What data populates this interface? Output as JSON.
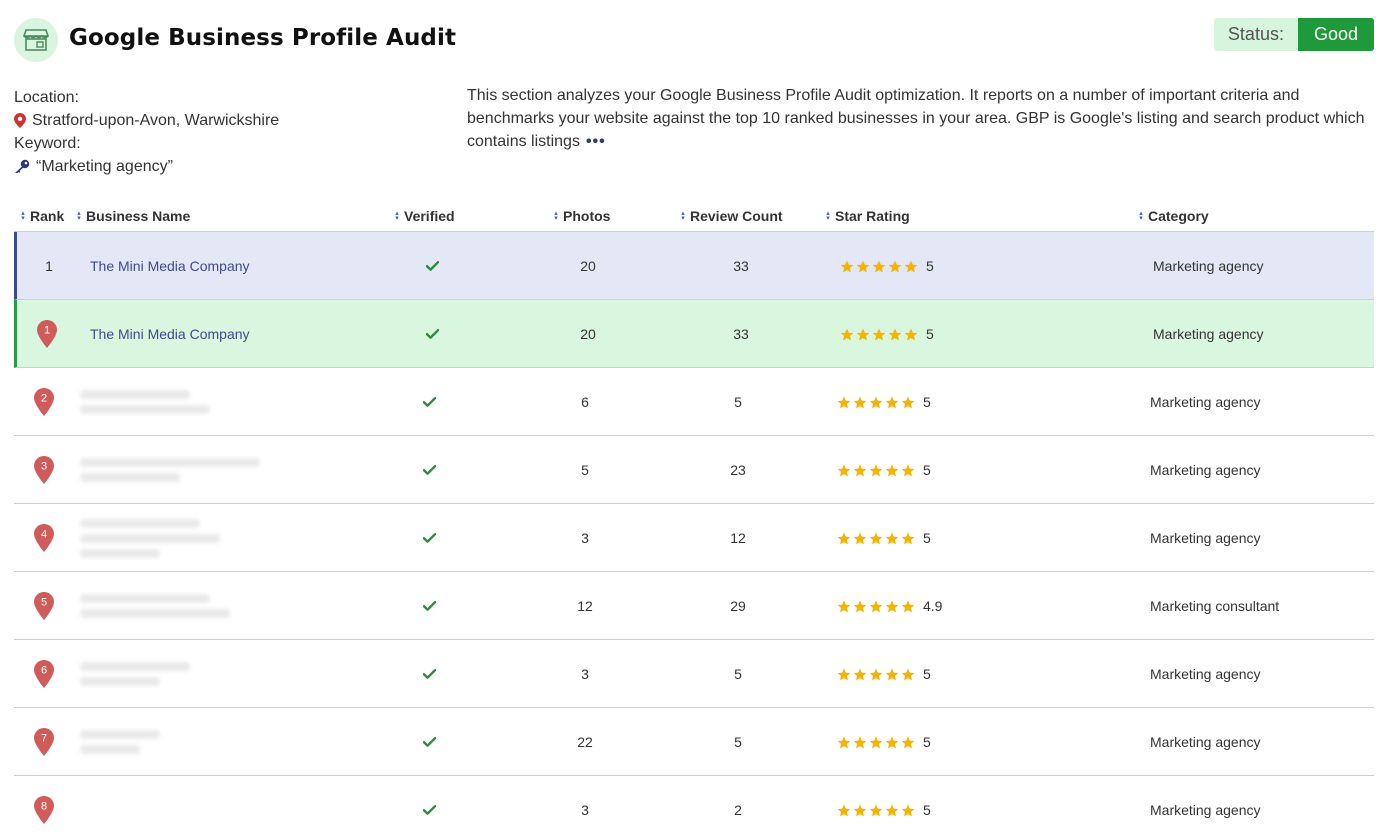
{
  "header": {
    "title": "Google Business Profile Audit",
    "status_label": "Status:",
    "status_value": "Good"
  },
  "meta": {
    "location_label": "Location:",
    "location_value": "Stratford-upon-Avon, Warwickshire",
    "keyword_label": "Keyword:",
    "keyword_value": "“Marketing agency”"
  },
  "description": {
    "text": "This section analyzes your Google Business Profile Audit optimization. It reports on a number of important criteria and benchmarks your website against the top 10 ranked businesses in your area. GBP is Google's listing and search product which contains listings",
    "more": "•••"
  },
  "table": {
    "columns": {
      "rank": "Rank",
      "name": "Business Name",
      "verified": "Verified",
      "photos": "Photos",
      "reviews": "Review Count",
      "rating": "Star Rating",
      "category": "Category"
    },
    "rows": [
      {
        "rank": "1",
        "name": "The Mini Media Company",
        "photos": "20",
        "reviews": "33",
        "rating": "5",
        "rating_value": 5,
        "category": "Marketing agency"
      },
      {
        "rank": "1",
        "name": "The Mini Media Company",
        "photos": "20",
        "reviews": "33",
        "rating": "5",
        "rating_value": 5,
        "category": "Marketing agency"
      },
      {
        "rank": "2",
        "name": "",
        "photos": "6",
        "reviews": "5",
        "rating": "5",
        "rating_value": 5,
        "category": "Marketing agency"
      },
      {
        "rank": "3",
        "name": "",
        "photos": "5",
        "reviews": "23",
        "rating": "5",
        "rating_value": 5,
        "category": "Marketing agency"
      },
      {
        "rank": "4",
        "name": "",
        "photos": "3",
        "reviews": "12",
        "rating": "5",
        "rating_value": 5,
        "category": "Marketing agency"
      },
      {
        "rank": "5",
        "name": "",
        "photos": "12",
        "reviews": "29",
        "rating": "4.9",
        "rating_value": 4.9,
        "category": "Marketing consultant"
      },
      {
        "rank": "6",
        "name": "",
        "photos": "3",
        "reviews": "5",
        "rating": "5",
        "rating_value": 5,
        "category": "Marketing agency"
      },
      {
        "rank": "7",
        "name": "",
        "photos": "22",
        "reviews": "5",
        "rating": "5",
        "rating_value": 5,
        "category": "Marketing agency"
      },
      {
        "rank": "8",
        "name": "",
        "photos": "3",
        "reviews": "2",
        "rating": "5",
        "rating_value": 5,
        "category": "Marketing agency"
      }
    ]
  },
  "colors": {
    "accent": "#3c4a8f",
    "good": "#1e9a3a",
    "pin": "#cf5b5b",
    "star": "#f5b400"
  },
  "icons": {
    "logo": "storefront-icon",
    "location": "map-pin-icon",
    "keyword": "key-icon",
    "verified": "checkmark-icon",
    "rank": "map-pin-icon"
  }
}
